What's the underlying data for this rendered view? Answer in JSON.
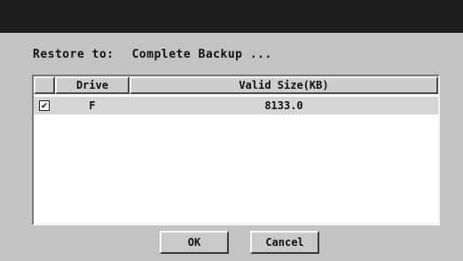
{
  "dialog": {
    "restore_label": "Restore to:",
    "restore_value": "Complete Backup ..."
  },
  "table": {
    "columns": [
      "",
      "Drive",
      "Valid Size(KB)"
    ],
    "rows": [
      {
        "checked": true,
        "check_glyph": "✔",
        "drive": "F",
        "valid_size_kb": "8133.0"
      }
    ]
  },
  "buttons": {
    "ok": "OK",
    "cancel": "Cancel"
  }
}
